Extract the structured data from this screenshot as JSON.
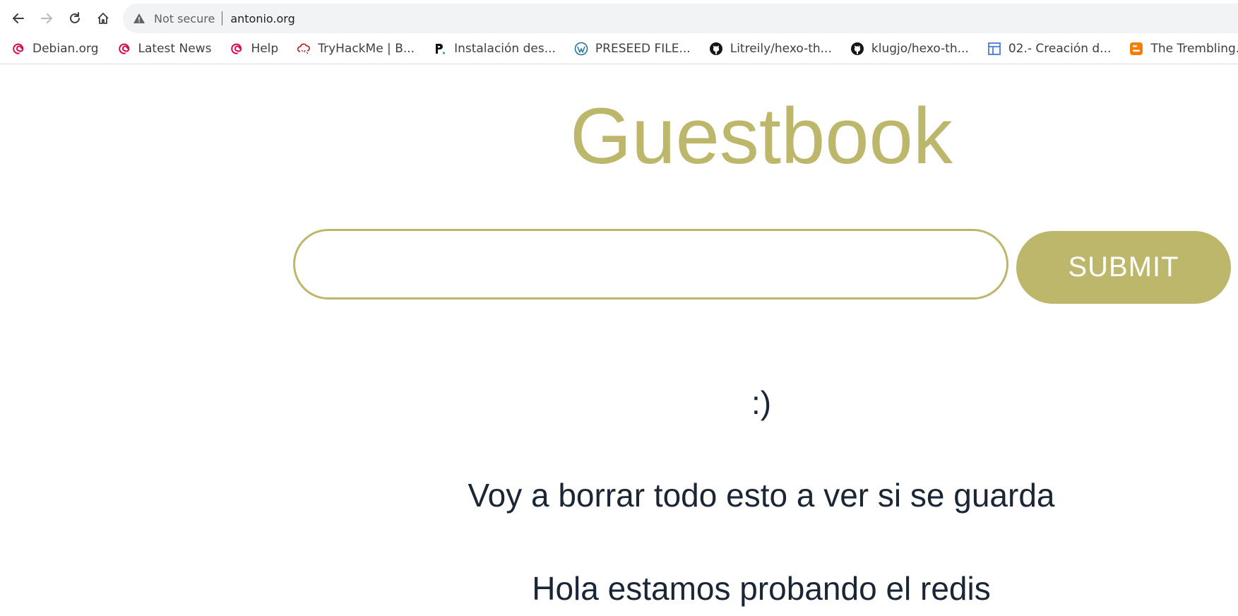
{
  "browser": {
    "security_status": "Not secure",
    "url": "antonio.org",
    "bookmarks": [
      {
        "label": "Debian.org",
        "icon": "debian-icon"
      },
      {
        "label": "Latest News",
        "icon": "debian-icon"
      },
      {
        "label": "Help",
        "icon": "debian-icon"
      },
      {
        "label": "TryHackMe | B...",
        "icon": "tryhackme-icon"
      },
      {
        "label": "Instalación des...",
        "icon": "p-logo-icon"
      },
      {
        "label": "PRESEED FILE...",
        "icon": "wordpress-icon"
      },
      {
        "label": "Litreily/hexo-th...",
        "icon": "github-icon"
      },
      {
        "label": "klugjo/hexo-th...",
        "icon": "github-icon"
      },
      {
        "label": "02.- Creación d...",
        "icon": "document-layout-icon"
      },
      {
        "label": "The Trembling...",
        "icon": "blogger-icon"
      }
    ]
  },
  "page": {
    "title": "Guestbook",
    "input": {
      "value": "",
      "placeholder": ""
    },
    "submit_label": "SUBMIT",
    "entries": [
      ":)",
      "Voy a borrar todo esto a ver si se guarda",
      "Hola estamos probando el redis"
    ]
  },
  "colors": {
    "accent": "#bdb76b",
    "entry_text": "#1a2535",
    "debian_red": "#d70751"
  }
}
